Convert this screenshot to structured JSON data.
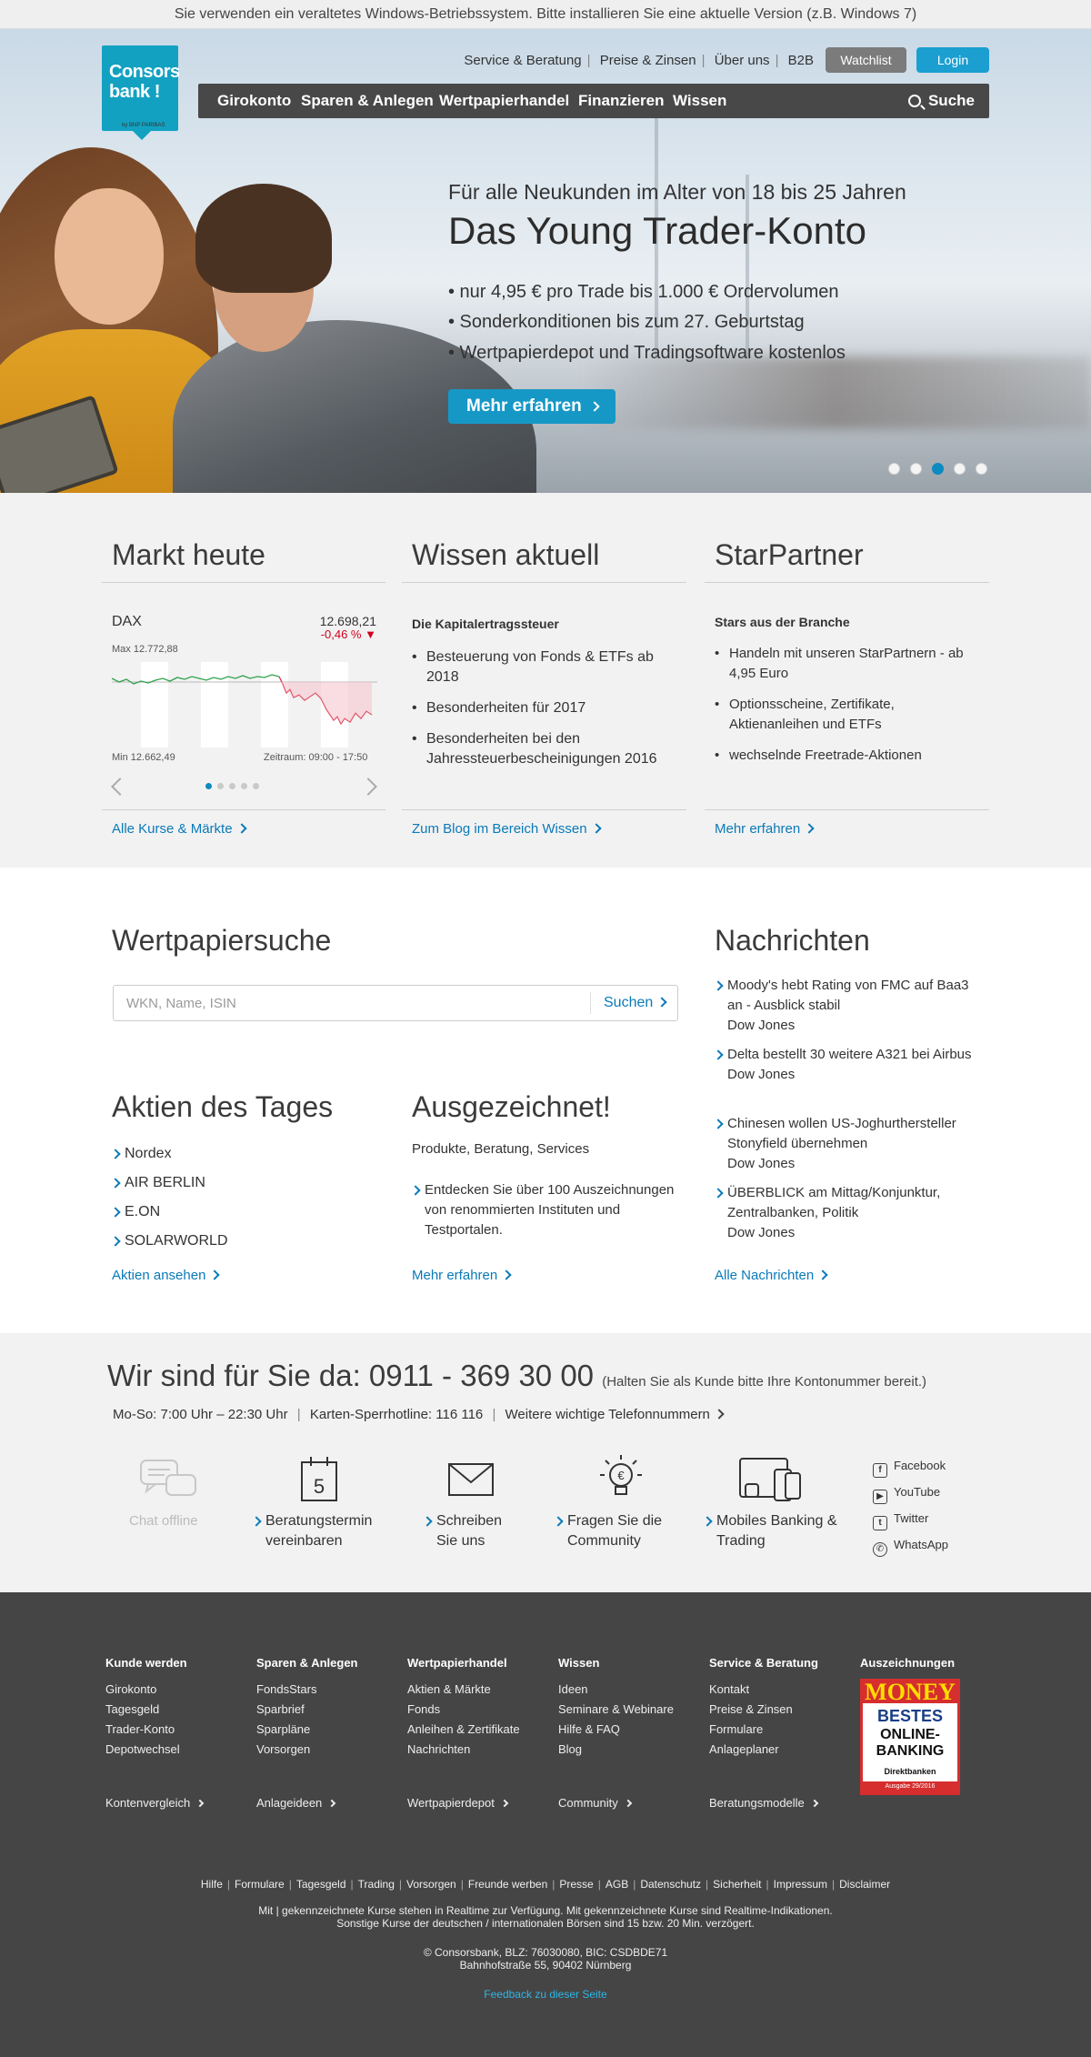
{
  "warning": "Sie verwenden ein veraltetes Windows-Betriebssystem. Bitte installieren Sie eine aktuelle Version (z.B. Windows 7)",
  "logo": {
    "line1": "Consors",
    "line2": "bank !",
    "sub": "by BNP PARIBAS"
  },
  "topnav": [
    "Service & Beratung",
    "Preise & Zinsen",
    "Über uns",
    "B2B"
  ],
  "buttons": {
    "watchlist": "Watchlist",
    "login": "Login"
  },
  "mainnav": [
    "Girokonto",
    "Sparen & Anlegen",
    "Wertpapierhandel",
    "Finanzieren",
    "Wissen"
  ],
  "search_label": "Suche",
  "hero": {
    "subtitle": "Für alle Neukunden im Alter von 18 bis 25 Jahren",
    "title": "Das Young Trader-Konto",
    "bullets": [
      "• nur 4,95 € pro Trade bis 1.000 € Ordervolumen",
      "• Sonderkonditionen bis zum 27. Geburtstag",
      "• Wertpapierdepot und Tradingsoftware kostenlos"
    ],
    "cta": "Mehr erfahren",
    "dots_total": 5,
    "dots_active": 3
  },
  "markt": {
    "title": "Markt heute",
    "index": "DAX",
    "value": "12.698,21",
    "change": "-0,46 %",
    "max": "Max 12.772,88",
    "min": "Min 12.662,49",
    "zeitraum": "Zeitraum: 09:00 - 17:50",
    "link": "Alle Kurse & Märkte"
  },
  "wissen": {
    "title": "Wissen aktuell",
    "subtitle": "Die Kapitalertragssteuer",
    "items": [
      "Besteuerung von Fonds & ETFs ab 2018",
      "Besonderheiten für 2017",
      "Besonderheiten bei den Jahressteuerbescheinigungen 2016"
    ],
    "link": "Zum Blog im Bereich Wissen"
  },
  "starpartner": {
    "title": "StarPartner",
    "subtitle": "Stars aus der Branche",
    "items": [
      "Handeln mit unseren StarPartnern - ab 4,95 Euro",
      "Optionsscheine, Zertifikate, Aktienanleihen und ETFs",
      "wechselnde Freetrade-Aktionen"
    ],
    "link": "Mehr erfahren"
  },
  "wpsuche": {
    "title": "Wertpapiersuche",
    "placeholder": "WKN, Name, ISIN",
    "button": "Suchen"
  },
  "aktien": {
    "title": "Aktien des Tages",
    "items": [
      "Nordex",
      "AIR BERLIN",
      "E.ON",
      "SOLARWORLD"
    ],
    "link": "Aktien ansehen"
  },
  "ausgezeichnet": {
    "title": "Ausgezeichnet!",
    "subtitle": "Produkte, Beratung, Services",
    "item": "Entdecken Sie über 100 Auszeichnungen von renommierten Instituten und Testportalen.",
    "link": "Mehr erfahren"
  },
  "nachrichten": {
    "title": "Nachrichten",
    "items": [
      {
        "text": "Moody's hebt Rating von FMC auf Baa3 an - Ausblick stabil",
        "source": "Dow Jones"
      },
      {
        "text": "Delta bestellt 30 weitere A321 bei Airbus",
        "source": "Dow Jones"
      },
      {
        "text": "Chinesen wollen US-Joghurthersteller Stonyfield übernehmen",
        "source": "Dow Jones"
      },
      {
        "text": "ÜBERBLICK am Mittag/Konjunktur, Zentralbanken, Politik",
        "source": "Dow Jones"
      }
    ],
    "link": "Alle Nachrichten"
  },
  "contact": {
    "title": "Wir sind für Sie da: 0911 - 369 30 00",
    "note": "(Halten Sie als Kunde bitte Ihre Kontonummer bereit.)",
    "hours": "Mo-So: 7:00 Uhr – 22:30 Uhr",
    "sperr": "Karten-Sperrhotline: 116 116",
    "more": "Weitere wichtige Telefonnummern",
    "items": [
      "Chat offline",
      "Beratungstermin vereinbaren",
      "Schreiben Sie uns",
      "Fragen Sie die Community",
      "Mobiles Banking & Trading"
    ],
    "calendar_day": "5",
    "social": [
      "Facebook",
      "YouTube",
      "Twitter",
      "WhatsApp"
    ]
  },
  "footer": {
    "columns": [
      {
        "head": "Kunde werden",
        "items": [
          "Girokonto",
          "Tagesgeld",
          "Trader-Konto",
          "Depotwechsel"
        ],
        "more": "Kontenvergleich"
      },
      {
        "head": "Sparen & Anlegen",
        "items": [
          "FondsStars",
          "Sparbrief",
          "Sparpläne",
          "Vorsorgen"
        ],
        "more": "Anlageideen"
      },
      {
        "head": "Wertpapierhandel",
        "items": [
          "Aktien & Märkte",
          "Fonds",
          "Anleihen & Zertifikate",
          "Nachrichten"
        ],
        "more": "Wertpapierdepot"
      },
      {
        "head": "Wissen",
        "items": [
          "Ideen",
          "Seminare & Webinare",
          "Hilfe & FAQ",
          "Blog"
        ],
        "more": "Community"
      },
      {
        "head": "Service & Beratung",
        "items": [
          "Kontakt",
          "Preise & Zinsen",
          "Formulare",
          "Anlageplaner"
        ],
        "more": "Beratungsmodelle"
      }
    ],
    "awards_head": "Auszeichnungen",
    "badge": {
      "brand": "MONEY",
      "l1": "BESTES",
      "l2": "ONLINE-",
      "l3": "BANKING",
      "l4": "Direktbanken",
      "l5": "Ausgabe 29/2016"
    },
    "bottom_links": [
      "Hilfe",
      "Formulare",
      "Tagesgeld",
      "Trading",
      "Vorsorgen",
      "Freunde werben",
      "Presse",
      "AGB",
      "Datenschutz",
      "Sicherheit",
      "Impressum",
      "Disclaimer"
    ],
    "note1": "Mit | gekennzeichnete Kurse stehen in Realtime zur Verfügung. Mit   gekennzeichnete Kurse sind Realtime-Indikationen.",
    "note2": "Sonstige Kurse der deutschen / internationalen Börsen sind 15 bzw. 20 Min. verzögert.",
    "company": "© Consorsbank, BLZ: 76030080, BIC: CSDBDE71",
    "address": "Bahnhofstraße 55, 90402 Nürnberg",
    "feedback": "Feedback zu dieser Seite"
  }
}
